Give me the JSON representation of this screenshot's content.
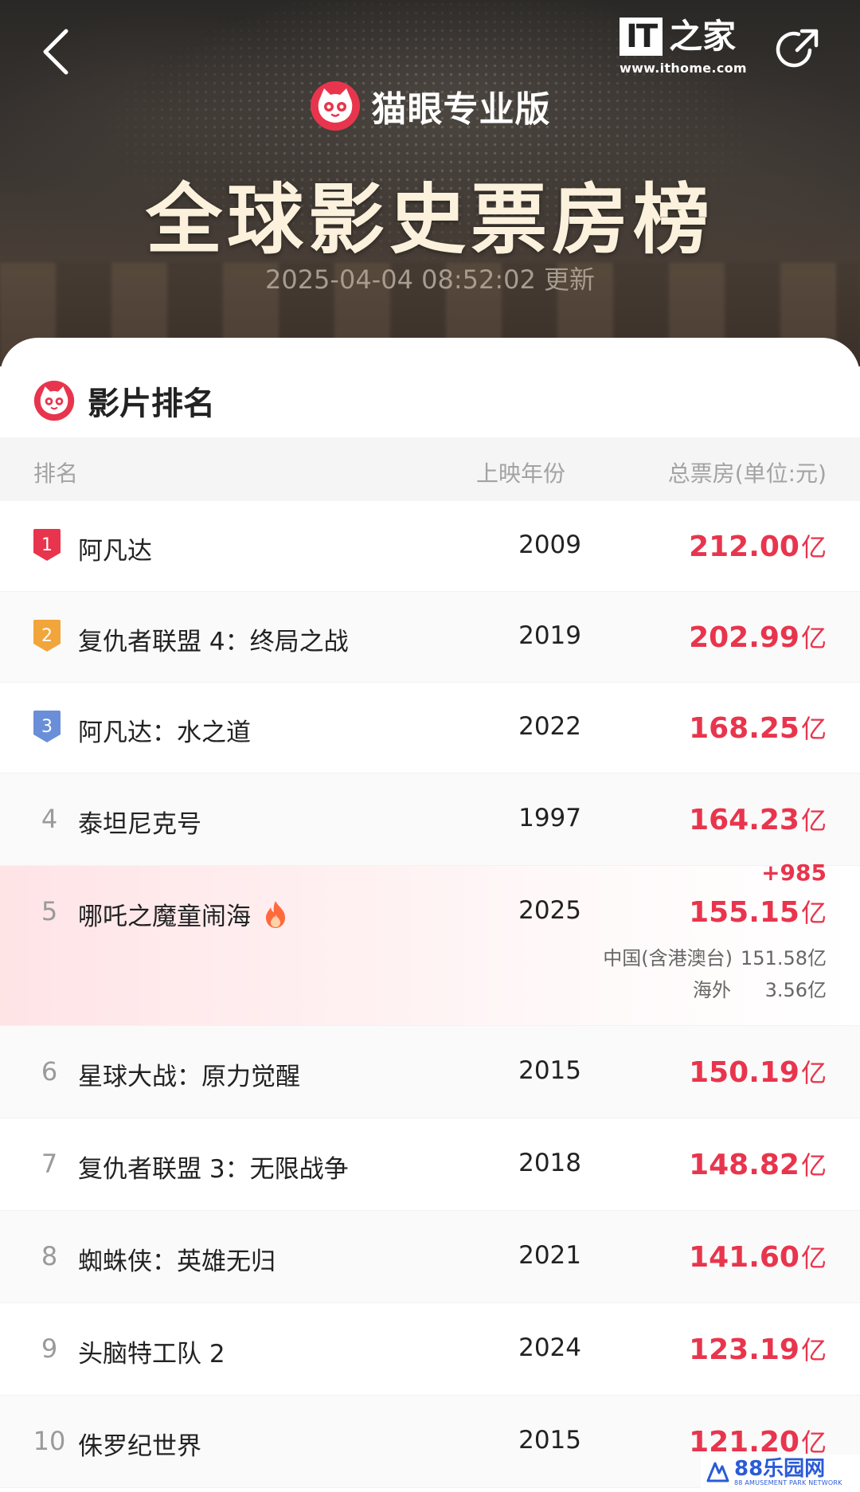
{
  "header": {
    "brand_name": "猫眼专业版",
    "title": "全球影史票房榜",
    "update_time": "2025-04-04 08:52:02 更新",
    "ithome_logo_text": "IT",
    "ithome_logo_cn": "之家",
    "ithome_url": "www.ithome.com"
  },
  "card": {
    "section_title": "影片排名",
    "columns": {
      "rank": "排名",
      "year": "上映年份",
      "gross": "总票房(单位:元)"
    }
  },
  "rows": [
    {
      "rank": "1",
      "title": "阿凡达",
      "year": "2009",
      "gross": "212.00",
      "unit": "亿"
    },
    {
      "rank": "2",
      "title": "复仇者联盟 4：终局之战",
      "year": "2019",
      "gross": "202.99",
      "unit": "亿"
    },
    {
      "rank": "3",
      "title": "阿凡达：水之道",
      "year": "2022",
      "gross": "168.25",
      "unit": "亿"
    },
    {
      "rank": "4",
      "title": "泰坦尼克号",
      "year": "1997",
      "gross": "164.23",
      "unit": "亿"
    },
    {
      "rank": "5",
      "title": "哪吒之魔童闹海",
      "year": "2025",
      "gross": "155.15",
      "unit": "亿",
      "delta": "+985",
      "breakdown": [
        {
          "label": "中国(含港澳台)",
          "value": "151.58亿"
        },
        {
          "label": "海外",
          "value": "3.56亿"
        }
      ]
    },
    {
      "rank": "6",
      "title": "星球大战：原力觉醒",
      "year": "2015",
      "gross": "150.19",
      "unit": "亿"
    },
    {
      "rank": "7",
      "title": "复仇者联盟 3：无限战争",
      "year": "2018",
      "gross": "148.82",
      "unit": "亿"
    },
    {
      "rank": "8",
      "title": "蜘蛛侠：英雄无归",
      "year": "2021",
      "gross": "141.60",
      "unit": "亿"
    },
    {
      "rank": "9",
      "title": "头脑特工队 2",
      "year": "2024",
      "gross": "123.19",
      "unit": "亿"
    },
    {
      "rank": "10",
      "title": "侏罗纪世界",
      "year": "2015",
      "gross": "121.20",
      "unit": "亿"
    }
  ],
  "watermark": {
    "text": "88乐园网",
    "sub": "88 AMUSEMENT PARK NETWORK"
  },
  "colors": {
    "accent": "#e8354d",
    "gold_badge": "#f2a53a",
    "blue_badge": "#6a8fd8",
    "red_badge": "#e8354d"
  }
}
